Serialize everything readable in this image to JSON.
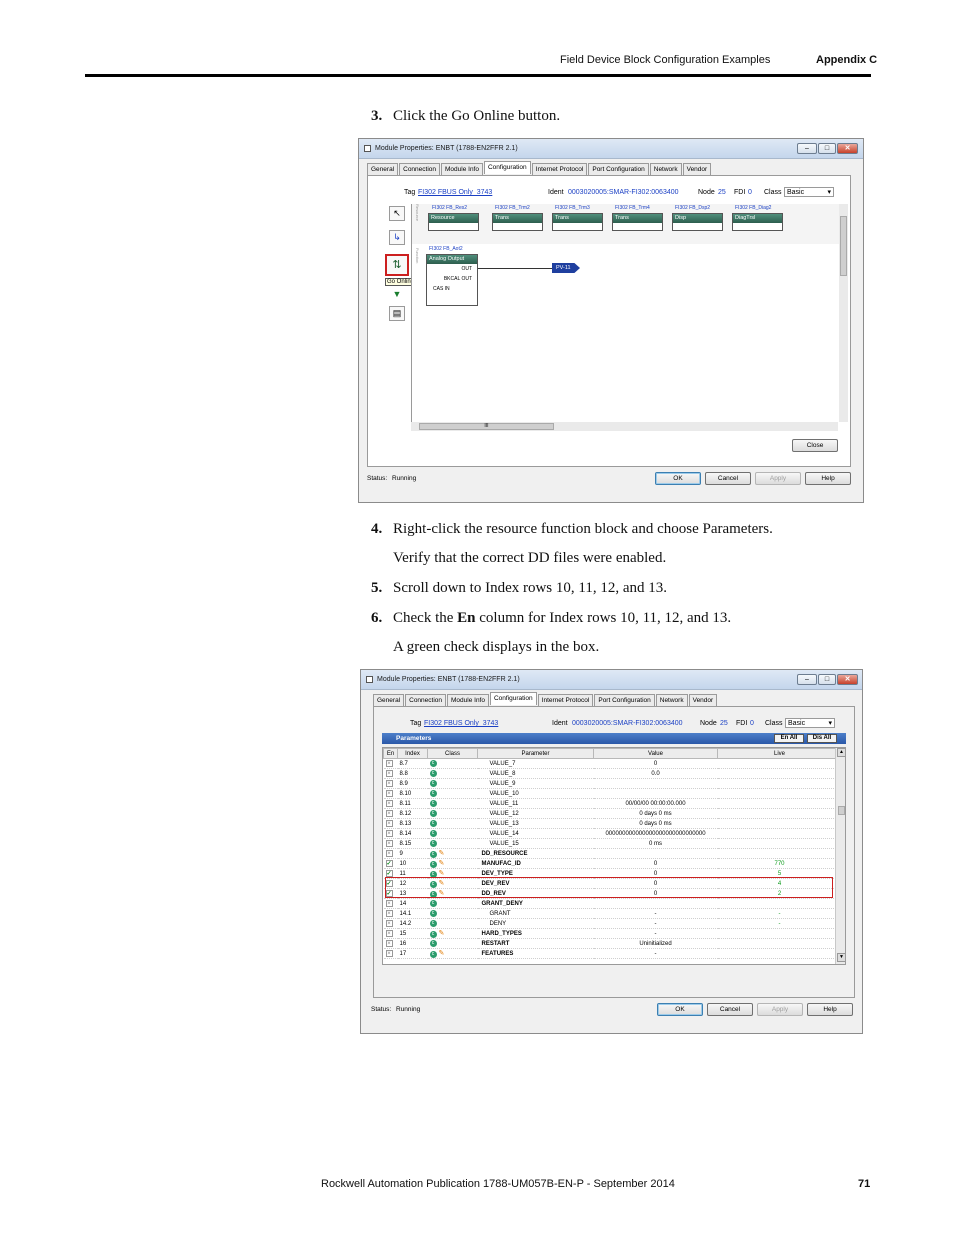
{
  "header": {
    "chapter_title": "Field Device Block Configuration Examples",
    "section": "Appendix C"
  },
  "steps": [
    {
      "num": "3.",
      "text": "Click the Go Online button."
    },
    {
      "num": "4.",
      "text": "Right-click the resource function block and choose Parameters."
    },
    {
      "num": "",
      "text": "Verify that the correct DD files were enabled."
    },
    {
      "num": "5.",
      "text": "Scroll down to Index rows 10, 11, 12, and 13."
    },
    {
      "num": "6.",
      "text_before": "Check the ",
      "text_bold": "En",
      "text_after": " column for Index rows 10, 11, 12, and 13."
    },
    {
      "num": "",
      "text": "A green check displays in the box."
    }
  ],
  "dialog": {
    "title": "Module Properties: ENBT (1788-EN2FFR 2.1)",
    "tabs": [
      "General",
      "Connection",
      "Module Info",
      "Configuration",
      "Internet Protocol",
      "Port Configuration",
      "Network",
      "Vendor"
    ],
    "active_tab": "Configuration",
    "tag_label": "Tag",
    "tag_value": "FI302 FBUS Only_3743",
    "ident_label": "Ident",
    "ident_value": "0003020005:SMAR-FI302:0063400",
    "node_label": "Node",
    "node_value": "25",
    "fdi_label": "FDI",
    "fdi_value": "0",
    "class_label": "Class",
    "class_value": "Basic",
    "status_label": "Status:",
    "status_value": "Running",
    "buttons": {
      "ok": "OK",
      "cancel": "Cancel",
      "apply": "Apply",
      "help": "Help",
      "close": "Close"
    }
  },
  "dialog1": {
    "resource_labels": [
      "FI302 FB_Res2",
      "FI302 FB_Trm2",
      "FI302 FB_Trm3",
      "FI302 FB_Trm4",
      "FI302 FB_Dsp2",
      "FI302 FB_Diag2"
    ],
    "resource_blocks": [
      "Resource",
      "Trans",
      "Trans",
      "Trans",
      "Disp",
      "DiagTrsl"
    ],
    "side_label_top": "Resource",
    "side_label_bottom": "Function",
    "ao_label": "FI302 FB_Aot2",
    "ao_block": "Analog Output",
    "ao_ports": [
      "OUT",
      "BKCAL OUT",
      "CAS IN"
    ],
    "tag_ref": "PV-11",
    "go_online_tooltip": "Go Online",
    "hscroll_text": "III"
  },
  "dialog2": {
    "params_title": "Parameters",
    "en_all": "En All",
    "dis_all": "Dis All",
    "columns": [
      "En",
      "Index",
      "Class",
      "Parameter",
      "Value",
      "Live"
    ],
    "rows": [
      {
        "en": false,
        "index": "8.7",
        "param": "VALUE_7",
        "value": "0",
        "live": "",
        "bold": false,
        "pen": false
      },
      {
        "en": false,
        "index": "8.8",
        "param": "VALUE_8",
        "value": "0.0",
        "live": "",
        "bold": false,
        "pen": false
      },
      {
        "en": false,
        "index": "8.9",
        "param": "VALUE_9",
        "value": "",
        "live": "",
        "bold": false,
        "pen": false
      },
      {
        "en": false,
        "index": "8.10",
        "param": "VALUE_10",
        "value": "",
        "live": "",
        "bold": false,
        "pen": false
      },
      {
        "en": false,
        "index": "8.11",
        "param": "VALUE_11",
        "value": "00/00/00 00:00:00.000",
        "live": "",
        "bold": false,
        "pen": false
      },
      {
        "en": false,
        "index": "8.12",
        "param": "VALUE_12",
        "value": "0 days 0 ms",
        "live": "",
        "bold": false,
        "pen": false
      },
      {
        "en": false,
        "index": "8.13",
        "param": "VALUE_13",
        "value": "0 days 0 ms",
        "live": "",
        "bold": false,
        "pen": false
      },
      {
        "en": false,
        "index": "8.14",
        "param": "VALUE_14",
        "value": "000000000000000000000000000000",
        "live": "",
        "bold": false,
        "pen": false
      },
      {
        "en": false,
        "index": "8.15",
        "param": "VALUE_15",
        "value": "0 ms",
        "live": "",
        "bold": false,
        "pen": false
      },
      {
        "en": false,
        "index": "9",
        "param": "DD_RESOURCE",
        "value": "",
        "live": "",
        "bold": true,
        "pen": true
      },
      {
        "en": true,
        "index": "10",
        "param": "MANUFAC_ID",
        "value": "0",
        "live": "770",
        "bold": true,
        "pen": true
      },
      {
        "en": true,
        "index": "11",
        "param": "DEV_TYPE",
        "value": "0",
        "live": "5",
        "bold": true,
        "pen": true
      },
      {
        "en": true,
        "index": "12",
        "param": "DEV_REV",
        "value": "0",
        "live": "4",
        "bold": true,
        "pen": true
      },
      {
        "en": true,
        "index": "13",
        "param": "DD_REV",
        "value": "0",
        "live": "2",
        "bold": true,
        "pen": true
      },
      {
        "en": false,
        "index": "14",
        "param": "GRANT_DENY",
        "value": "",
        "live": "",
        "bold": true,
        "pen": false
      },
      {
        "en": false,
        "index": "14.1",
        "param": "GRANT",
        "value": "-",
        "live": "-",
        "bold": false,
        "pen": false
      },
      {
        "en": false,
        "index": "14.2",
        "param": "DENY",
        "value": "-",
        "live": "-",
        "bold": false,
        "pen": false
      },
      {
        "en": false,
        "index": "15",
        "param": "HARD_TYPES",
        "value": "-",
        "live": "",
        "bold": true,
        "pen": true
      },
      {
        "en": false,
        "index": "16",
        "param": "RESTART",
        "value": "Uninitialized",
        "live": "",
        "bold": true,
        "pen": false
      },
      {
        "en": false,
        "index": "17",
        "param": "FEATURES",
        "value": "-",
        "live": "",
        "bold": true,
        "pen": true
      }
    ]
  },
  "icons": [
    "arrow-pointer-icon",
    "wire-connect-icon",
    "go-online-icon",
    "download-icon",
    "print-icon",
    "class-icon",
    "edit-pencil-icon"
  ],
  "colors": {
    "highlight_red": "#cc1f1f",
    "check_green": "#0a8a18",
    "params_blue": "#2a58a8",
    "block_green": "#2d5e4e"
  },
  "footer": {
    "publication": "Rockwell Automation Publication 1788-UM057B-EN-P - September 2014",
    "page_number": "71"
  }
}
